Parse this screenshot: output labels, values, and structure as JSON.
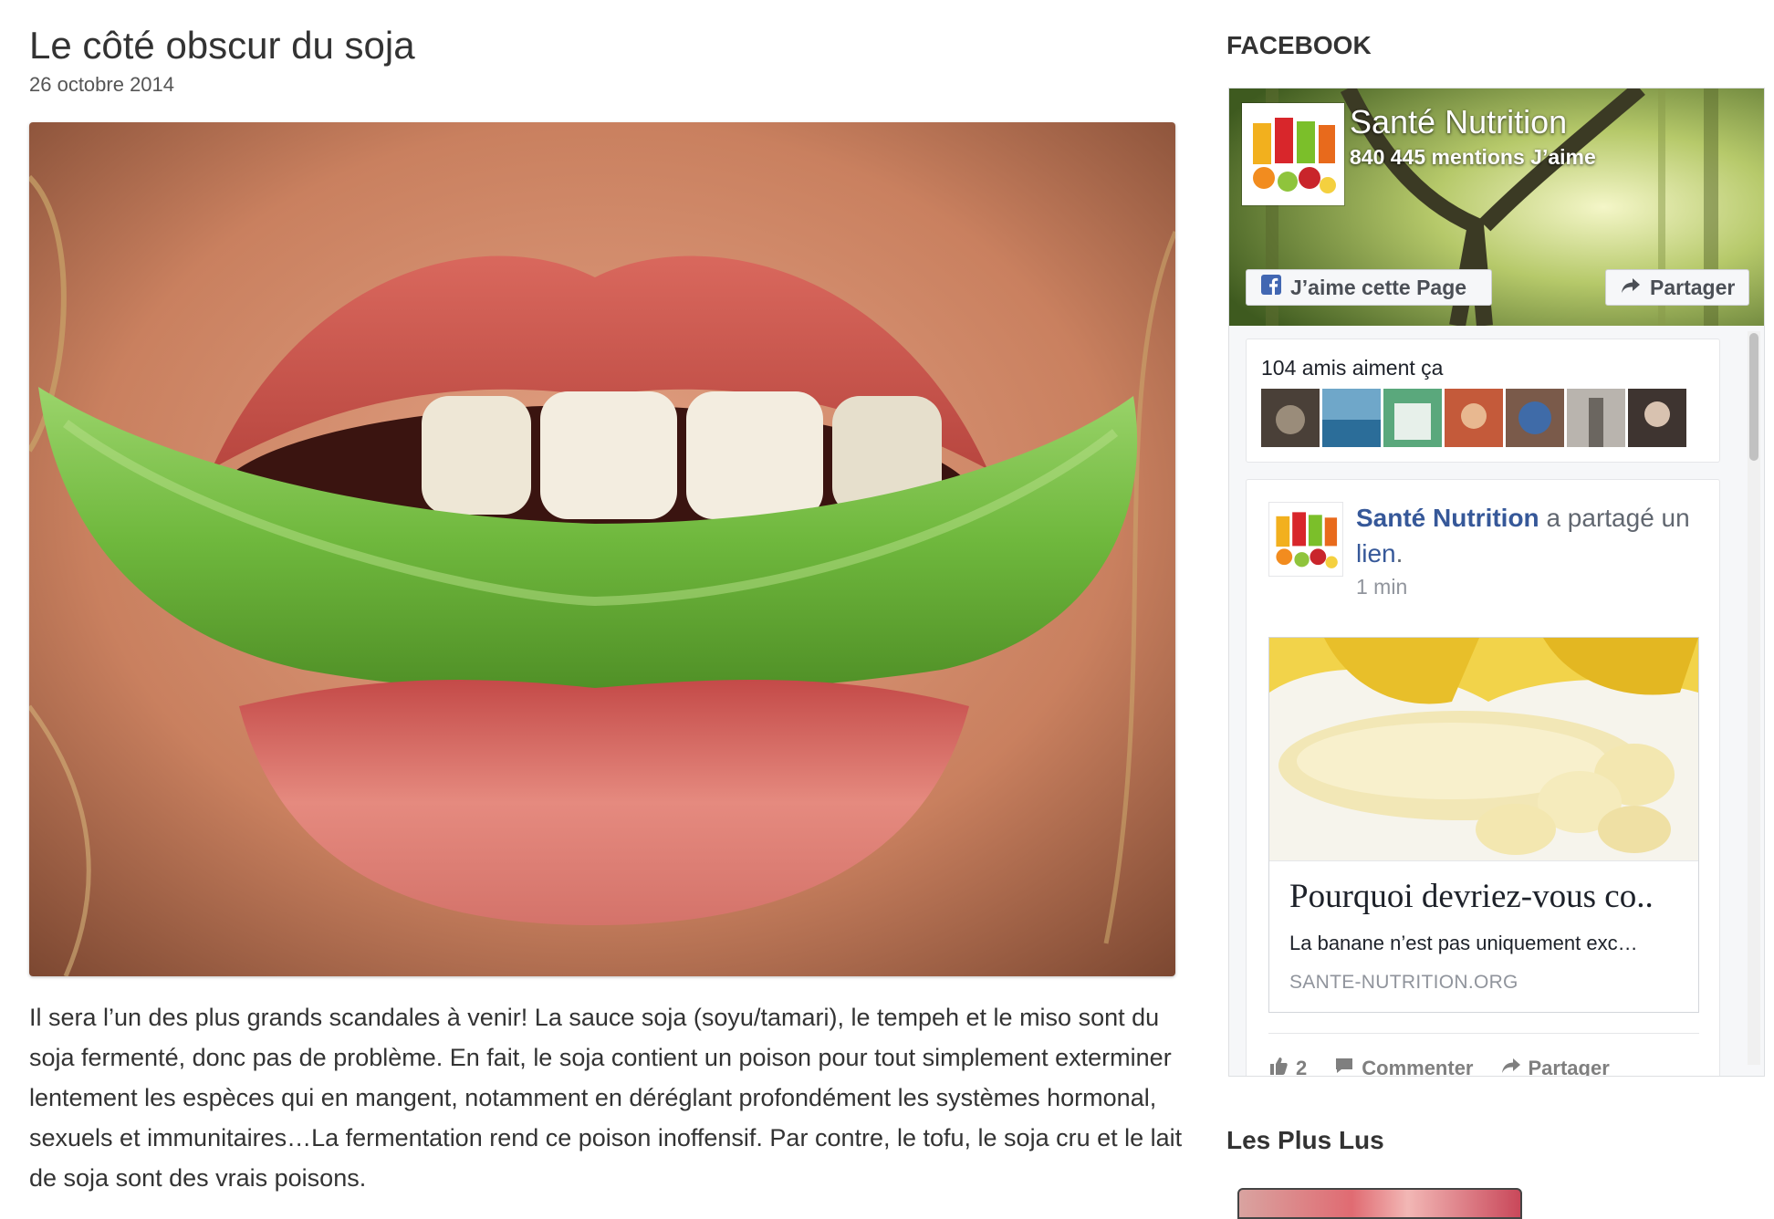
{
  "article": {
    "title": "Le côté obscur du soja",
    "date": "26 octobre 2014",
    "body": "Il sera l’un des plus grands scandales à venir! La sauce soja (soyu/tamari), le tempeh et le miso sont du soja fermenté, donc pas de problème. En fait, le soja contient un poison pour tout simplement exterminer lentement les espèces qui en mangent, notamment en déréglant profondément les systèmes hormonal, sexuels et immunitaires…La fermentation rend ce poison inoffensif. Par contre, le tofu, le soja cru et le lait de soja sont des vrais poisons."
  },
  "sidebar": {
    "facebook_heading": "FACEBOOK",
    "most_read_heading": "Les Plus Lus"
  },
  "fb": {
    "page_name": "Santé Nutrition",
    "likes_text": "840 445 mentions J’aime",
    "like_button": "J’aime cette Page",
    "share_button": "Partager",
    "friends_text": "104 amis aiment ça",
    "post": {
      "author": "Santé Nutrition",
      "action_text": "a partagé un",
      "link_word": "lien",
      "period": ".",
      "time": "1 min",
      "link_title": "Pourquoi devriez-vous co..",
      "link_desc": "La banane n’est pas uniquement exc…",
      "link_domain": "SANTE-NUTRITION.ORG",
      "like_count": "2",
      "comment_label": "Commenter",
      "share_label": "Partager"
    }
  },
  "colors": {
    "facebook_blue": "#365899",
    "facebook_icon": "#4267b2"
  }
}
